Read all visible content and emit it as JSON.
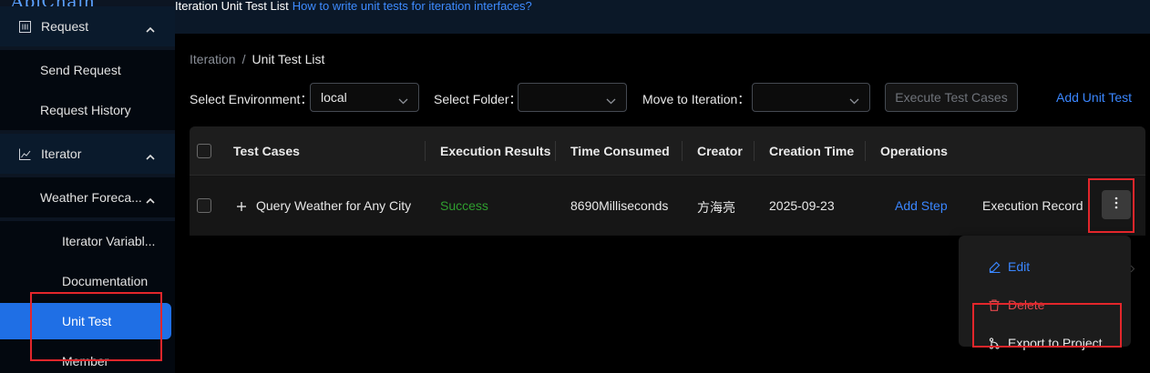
{
  "app": {
    "logo_text": "ApiChain"
  },
  "header": {
    "title": "Iteration Unit Test List",
    "help_link": "How to write unit tests for iteration interfaces?"
  },
  "sidebar": {
    "request_group": {
      "label": "Request",
      "icon": "request-icon",
      "expanded": true
    },
    "send_request": "Send Request",
    "request_history": "Request History",
    "iterator_group": {
      "label": "Iterator",
      "icon": "chart-line-icon",
      "expanded": true
    },
    "weather_group": {
      "label": "Weather Foreca...",
      "expanded": true
    },
    "iterator_variables": "Iterator Variabl...",
    "documentation": "Documentation",
    "unit_test": "Unit Test",
    "member": "Member"
  },
  "breadcrumb": {
    "parent": "Iteration",
    "separator": "/",
    "current": "Unit Test List"
  },
  "filters": {
    "environment_label": "Select Environment：",
    "environment_value": "local",
    "folder_label": "Select Folder：",
    "folder_value": "",
    "iteration_label": "Move to Iteration：",
    "iteration_value": "",
    "execute_button": "Execute Test Cases",
    "add_button": "Add Unit Test"
  },
  "table": {
    "columns": [
      "Test Cases",
      "Execution Results",
      "Time Consumed",
      "Creator",
      "Creation Time",
      "Operations"
    ],
    "rows": [
      {
        "test_case": "Query Weather for Any City",
        "result": "Success",
        "time_consumed": "8690Milliseconds",
        "creator": "方海亮",
        "creation_time": "2025-09-23",
        "op_add_step": "Add Step",
        "op_record": "Execution Record"
      }
    ]
  },
  "dropdown_menu": {
    "edit": "Edit",
    "delete": "Delete",
    "export": "Export to Project"
  },
  "colors": {
    "accent": "#1f6fe5",
    "link": "#3a86ff",
    "success": "#2f9e2f",
    "danger": "#e5484d",
    "highlight_box": "#e3262b"
  }
}
